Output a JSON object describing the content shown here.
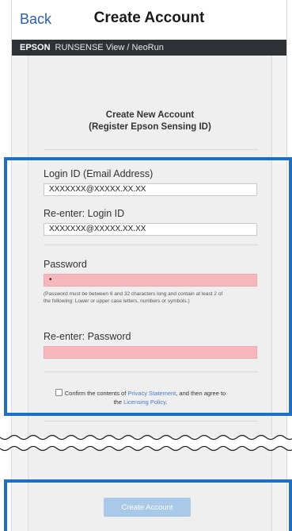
{
  "navbar": {
    "back_label": "Back",
    "title": "Create Account"
  },
  "appbar": {
    "brand": "EPSON",
    "product": "RUNSENSE View / NeoRun"
  },
  "heading": {
    "line1": "Create New Account",
    "line2": "(Register Epson Sensing ID)"
  },
  "form": {
    "login_id": {
      "label": "Login ID (Email Address)",
      "value": "XXXXXXX@XXXXX.XX.XX"
    },
    "reenter_login_id": {
      "label": "Re-enter: Login ID",
      "value": "XXXXXXX@XXXXX.XX.XX"
    },
    "password": {
      "label": "Password",
      "value": "•"
    },
    "password_note_line1": "(Password must be between 8 and 32 characters long and contain at least 2 of",
    "password_note_line2": "the following: Lower or upper case letters, numbers or symbols.)",
    "reenter_password": {
      "label": "Re-enter: Password",
      "value": ""
    },
    "consent": {
      "before": "Confirm the contents of ",
      "privacy_link": "Privacy Statement",
      "middle": ", and then agree to",
      "the": "the ",
      "licensing_link": "Licensing Policy",
      "after": "."
    }
  },
  "create_button_label": "Create Account",
  "colors": {
    "highlight": "#1f6fc4",
    "error_field": "#f6b8bd",
    "link": "#4a79c6",
    "button": "#a9c9e8"
  }
}
